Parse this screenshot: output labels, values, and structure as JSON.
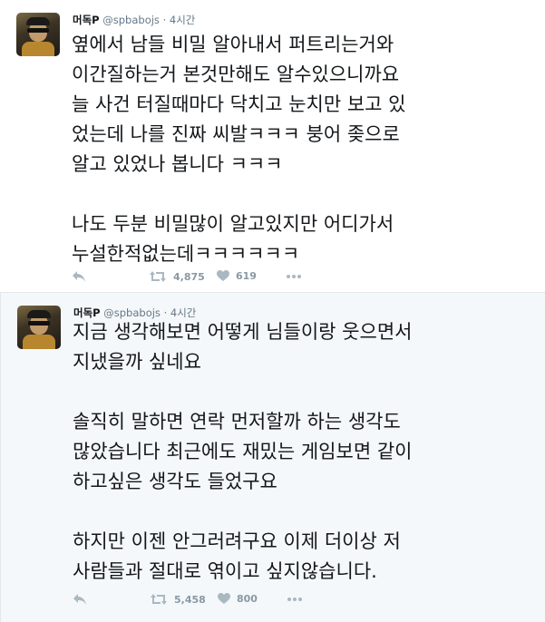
{
  "tweets": [
    {
      "author": {
        "name": "머독P",
        "handle": "@spbabojs"
      },
      "separator": "·",
      "time": "4시간",
      "text": "옆에서 남들 비밀 알아내서 퍼트리는거와\n이간질하는거 본것만해도 알수있으니까요\n늘 사건 터질때마다 닥치고 눈치만 보고 있\n었는데 나를 진짜 씨발ㅋㅋㅋ 붕어 좆으로\n알고 있었나 봅니다 ㅋㅋㅋ\n\n나도 두분 비밀많이 알고있지만 어디가서\n누설한적없는데ㅋㅋㅋㅋㅋㅋ",
      "retweets": "4,875",
      "likes": "619"
    },
    {
      "author": {
        "name": "머독P",
        "handle": "@spbabojs"
      },
      "separator": "·",
      "time": "4시간",
      "text": "지금 생각해보면 어떻게 님들이랑 웃으면서\n지냈을까 싶네요\n\n솔직히 말하면 연락 먼저할까 하는 생각도\n많았습니다 최근에도 재밌는 게임보면 같이\n하고싶은 생각도 들었구요\n\n하지만 이젠 안그러려구요 이제 더이상 저\n사람들과 절대로 엮이고 싶지않습니다.",
      "retweets": "5,458",
      "likes": "800"
    }
  ],
  "icons": {
    "reply": "reply-icon",
    "retweet": "retweet-icon",
    "like": "heart-icon",
    "more": "more-icon"
  },
  "colors": {
    "text": "#14171a",
    "secondary": "#657786",
    "action_icon": "#aab8c2",
    "alt_background": "#f5f8fa"
  }
}
